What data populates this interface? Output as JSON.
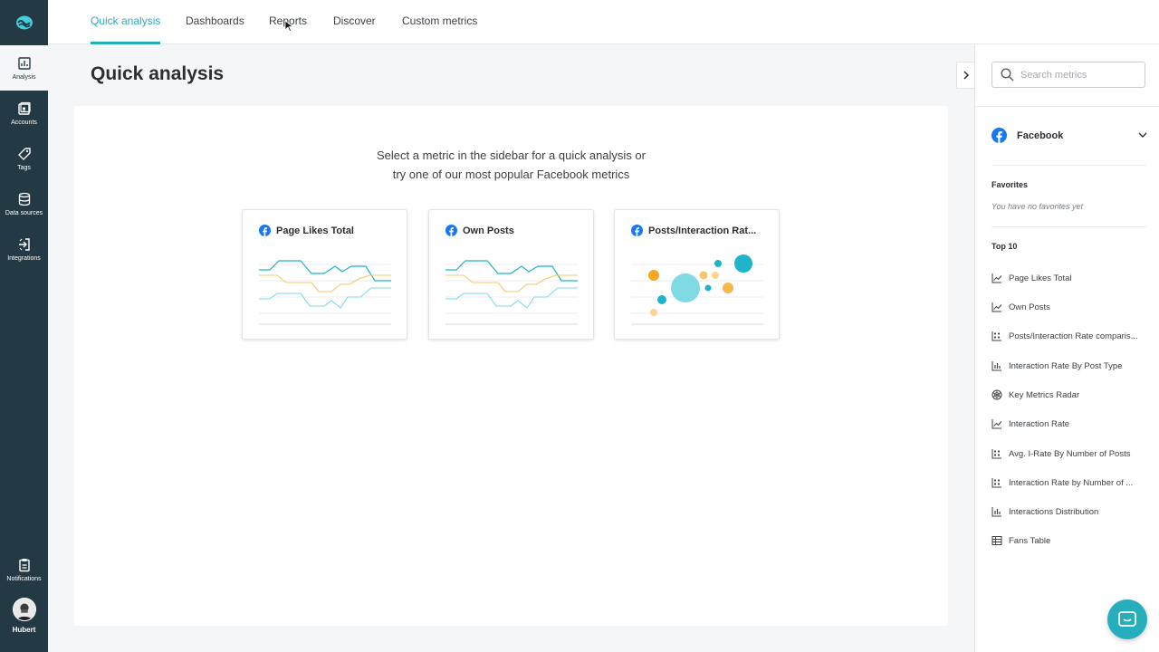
{
  "nav": {
    "items": [
      {
        "label": "Analysis",
        "icon": "bar-chart-icon"
      },
      {
        "label": "Accounts",
        "icon": "accounts-icon"
      },
      {
        "label": "Tags",
        "icon": "tag-icon"
      },
      {
        "label": "Data sources",
        "icon": "database-icon"
      },
      {
        "label": "Integrations",
        "icon": "integrations-icon"
      },
      {
        "label": "Notifications",
        "icon": "clipboard-icon"
      }
    ],
    "user": "Hubert"
  },
  "tabs": [
    "Quick analysis",
    "Dashboards",
    "Reports",
    "Discover",
    "Custom metrics"
  ],
  "main": {
    "title": "Quick analysis",
    "intro_line1": "Select a metric in the sidebar for a quick analysis or",
    "intro_line2": "try one of our most popular Facebook metrics",
    "cards": [
      {
        "title": "Page Likes Total",
        "chart": "line"
      },
      {
        "title": "Own Posts",
        "chart": "line"
      },
      {
        "title": "Posts/Interaction Rat...",
        "chart": "bubble"
      }
    ]
  },
  "sidebar": {
    "search_placeholder": "Search metrics",
    "network": "Facebook",
    "favorites_title": "Favorites",
    "favorites_empty": "You have no favorites yet",
    "top_title": "Top 10",
    "metrics": [
      {
        "label": "Page Likes Total",
        "icon": "line-chart-icon"
      },
      {
        "label": "Own Posts",
        "icon": "line-chart-icon"
      },
      {
        "label": "Posts/Interaction Rate comparis...",
        "icon": "bubble-chart-icon"
      },
      {
        "label": "Interaction Rate By Post Type",
        "icon": "bar-chart-icon"
      },
      {
        "label": "Key Metrics Radar",
        "icon": "radar-icon"
      },
      {
        "label": "Interaction Rate",
        "icon": "line-chart-icon"
      },
      {
        "label": "Avg. I-Rate By Number of Posts",
        "icon": "bubble-chart-icon"
      },
      {
        "label": "Interaction Rate by Number of ...",
        "icon": "bubble-chart-icon"
      },
      {
        "label": "Interactions Distribution",
        "icon": "bar-chart-icon"
      },
      {
        "label": "Fans Table",
        "icon": "table-icon"
      }
    ]
  },
  "colors": {
    "accent": "#26aebd",
    "nav": "#233a44",
    "facebook": "#1877f2",
    "orange": "#f5a623",
    "teal": "#1fb4c9"
  }
}
